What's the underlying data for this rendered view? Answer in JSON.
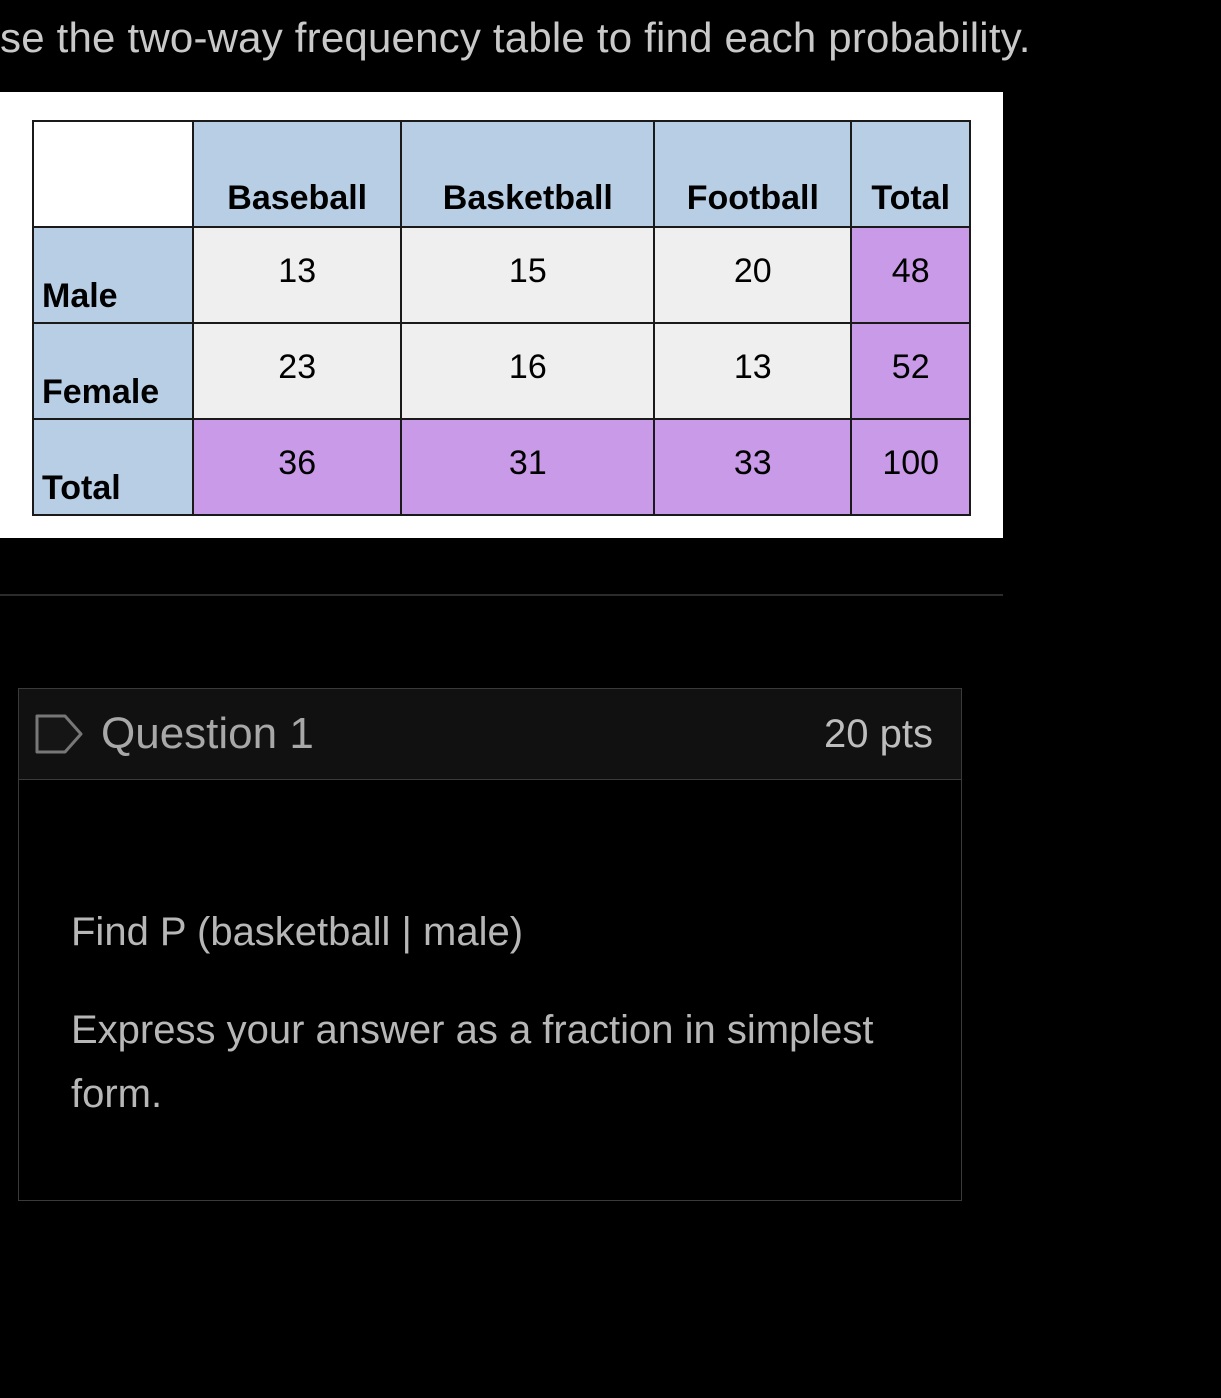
{
  "instruction": "se the two-way frequency table to find each probability.",
  "table": {
    "corner": "",
    "columns": [
      "Baseball",
      "Basketball",
      "Football",
      "Total"
    ],
    "rows": [
      {
        "label": "Male",
        "cells": [
          "13",
          "15",
          "20",
          "48"
        ]
      },
      {
        "label": "Female",
        "cells": [
          "23",
          "16",
          "13",
          "52"
        ]
      },
      {
        "label": "Total",
        "cells": [
          "36",
          "31",
          "33",
          "100"
        ]
      }
    ]
  },
  "question": {
    "title": "Question 1",
    "points": "20 pts",
    "prompt1": "Find P (basketball | male)",
    "prompt2": "Express your answer as a fraction in simplest form."
  },
  "chart_data": {
    "type": "table",
    "title": "Two-way frequency table",
    "row_labels": [
      "Male",
      "Female",
      "Total"
    ],
    "column_labels": [
      "Baseball",
      "Basketball",
      "Football",
      "Total"
    ],
    "values": [
      [
        13,
        15,
        20,
        48
      ],
      [
        23,
        16,
        13,
        52
      ],
      [
        36,
        31,
        33,
        100
      ]
    ]
  }
}
